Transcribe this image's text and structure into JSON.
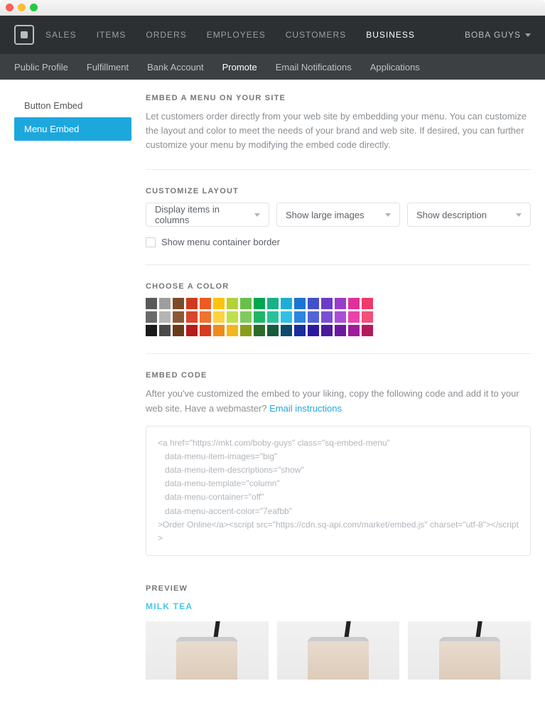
{
  "topnav": {
    "items": [
      "SALES",
      "ITEMS",
      "ORDERS",
      "EMPLOYEES",
      "CUSTOMERS",
      "BUSINESS"
    ],
    "active_index": 5,
    "user": "BOBA GUYS"
  },
  "subnav": {
    "items": [
      "Public Profile",
      "Fulfillment",
      "Bank Account",
      "Promote",
      "Email Notifications",
      "Applications"
    ],
    "active_index": 3
  },
  "sidebar": {
    "items": [
      "Button Embed",
      "Menu Embed"
    ],
    "active_index": 1
  },
  "embed": {
    "title": "EMBED A MENU ON YOUR SITE",
    "desc": "Let customers order directly from your web site by embedding your menu. You can customize the layout and color to meet the needs of your brand and web site. If desired, you can further customize your menu by modifying the embed code directly."
  },
  "layout": {
    "title": "CUSTOMIZE LAYOUT",
    "select1": "Display items in columns",
    "select2": "Show large images",
    "select3": "Show description",
    "checkbox_label": "Show menu container border"
  },
  "color": {
    "title": "CHOOSE A COLOR",
    "rows": [
      [
        "#595959",
        "#9e9e9e",
        "#7c4a2a",
        "#cc3b1f",
        "#f05a22",
        "#ffc20e",
        "#b2d235",
        "#6abf4b",
        "#00a651",
        "#1ab188",
        "#1caed7",
        "#1b75d0",
        "#4251c9",
        "#6a3cc9",
        "#9a3cc9",
        "#e0309a",
        "#ef3a6a"
      ],
      [
        "#6a6a6a",
        "#b5b5b5",
        "#8c5735",
        "#d9462b",
        "#f2712d",
        "#ffd23f",
        "#c0e04b",
        "#7ecb5c",
        "#1cb764",
        "#27c29a",
        "#2fc0e4",
        "#2d86df",
        "#5464d6",
        "#7a4fd6",
        "#a94fd6",
        "#ec41ab",
        "#f25079"
      ],
      [
        "#1a1a1a",
        "#4a4a4a",
        "#6b3a1a",
        "#b41b1b",
        "#d83b1b",
        "#ee8b1b",
        "#f3b61b",
        "#8a9e1b",
        "#2b6b2b",
        "#165b3d",
        "#0e4a6b",
        "#1a2e9e",
        "#2b1a9e",
        "#4a1a9e",
        "#6b1a9e",
        "#9e1a9e",
        "#b41a5b"
      ]
    ]
  },
  "code": {
    "title": "EMBED CODE",
    "desc": "After you've customized the embed to your liking, copy the following code and add it to your web site. Have a webmaster? ",
    "link": "Email instructions",
    "content": "<a href=\"https://mkt.com/boby-guys\" class=\"sq-embed-menu\"\n   data-menu-item-images=\"big\"\n   data-menu-item-descriptions=\"show\"\n   data-menu-template=\"column\"\n   data-menu-container=\"off\"\n   data-menu-accent-color=\"7eafbb\"\n>Order Online</a><script src=\"https://cdn.sq-api.com/market/embed.js\" charset=\"utf-8\"></script>"
  },
  "preview": {
    "title": "PREVIEW",
    "category": "MILK TEA"
  }
}
